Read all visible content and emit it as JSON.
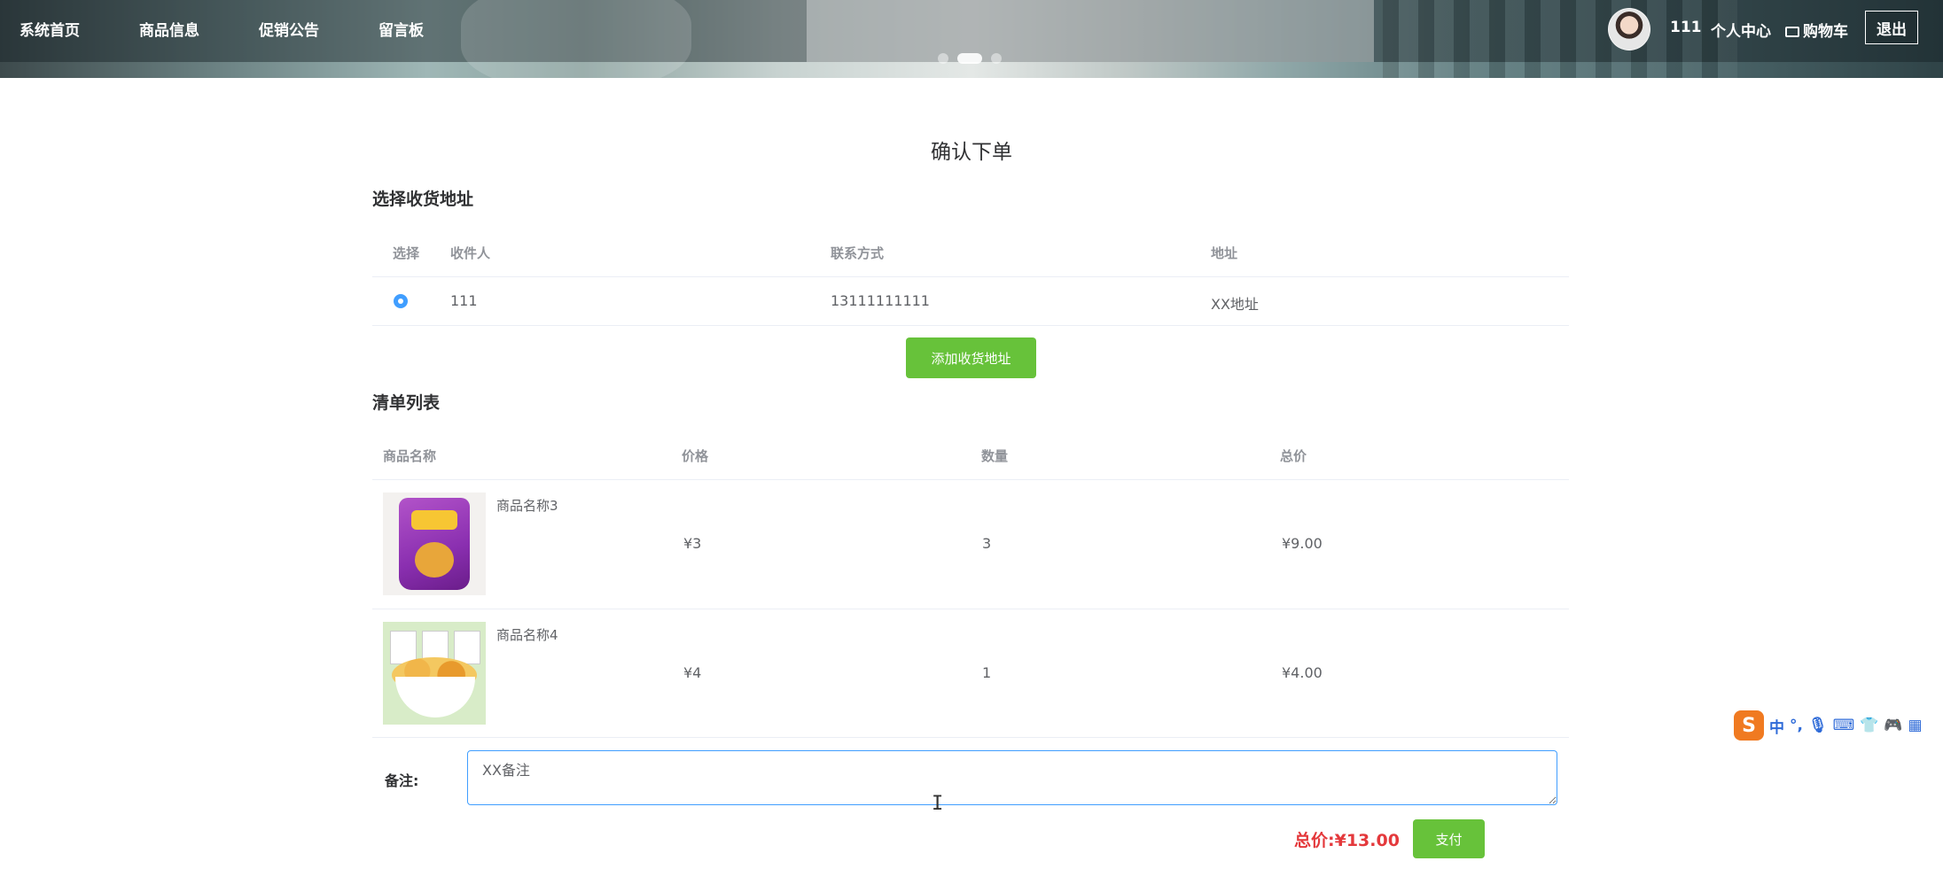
{
  "header": {
    "nav": [
      "系统首页",
      "商品信息",
      "促销公告",
      "留言板"
    ],
    "username": "111",
    "profile": "个人中心",
    "cart": "购物车",
    "logout": "退出"
  },
  "page_title": "确认下单",
  "address_section": {
    "title": "选择收货地址",
    "columns": [
      "选择",
      "收件人",
      "联系方式",
      "地址"
    ],
    "rows": [
      {
        "name": "111",
        "phone": "13111111111",
        "address": "XX地址",
        "selected": true
      }
    ],
    "add_button": "添加收货地址"
  },
  "order_section": {
    "title": "清单列表",
    "columns": [
      "商品名称",
      "价格",
      "数量",
      "总价"
    ],
    "rows": [
      {
        "name": "商品名称3",
        "price": "¥3",
        "qty": "3",
        "total": "¥9.00"
      },
      {
        "name": "商品名称4",
        "price": "¥4",
        "qty": "1",
        "total": "¥4.00"
      }
    ]
  },
  "remark": {
    "label": "备注:",
    "value": "XX备注"
  },
  "summary": {
    "total_label": "总价:",
    "total_value": "¥13.00",
    "pay_button": "支付"
  },
  "ime_toolbar": {
    "lang": "中",
    "items": [
      "punctuation-icon",
      "mic-icon",
      "keyboard-icon",
      "skin-icon",
      "game-icon",
      "apps-icon"
    ]
  },
  "colors": {
    "primary": "#409eff",
    "success": "#67c23a",
    "price_red": "#e4393c"
  }
}
